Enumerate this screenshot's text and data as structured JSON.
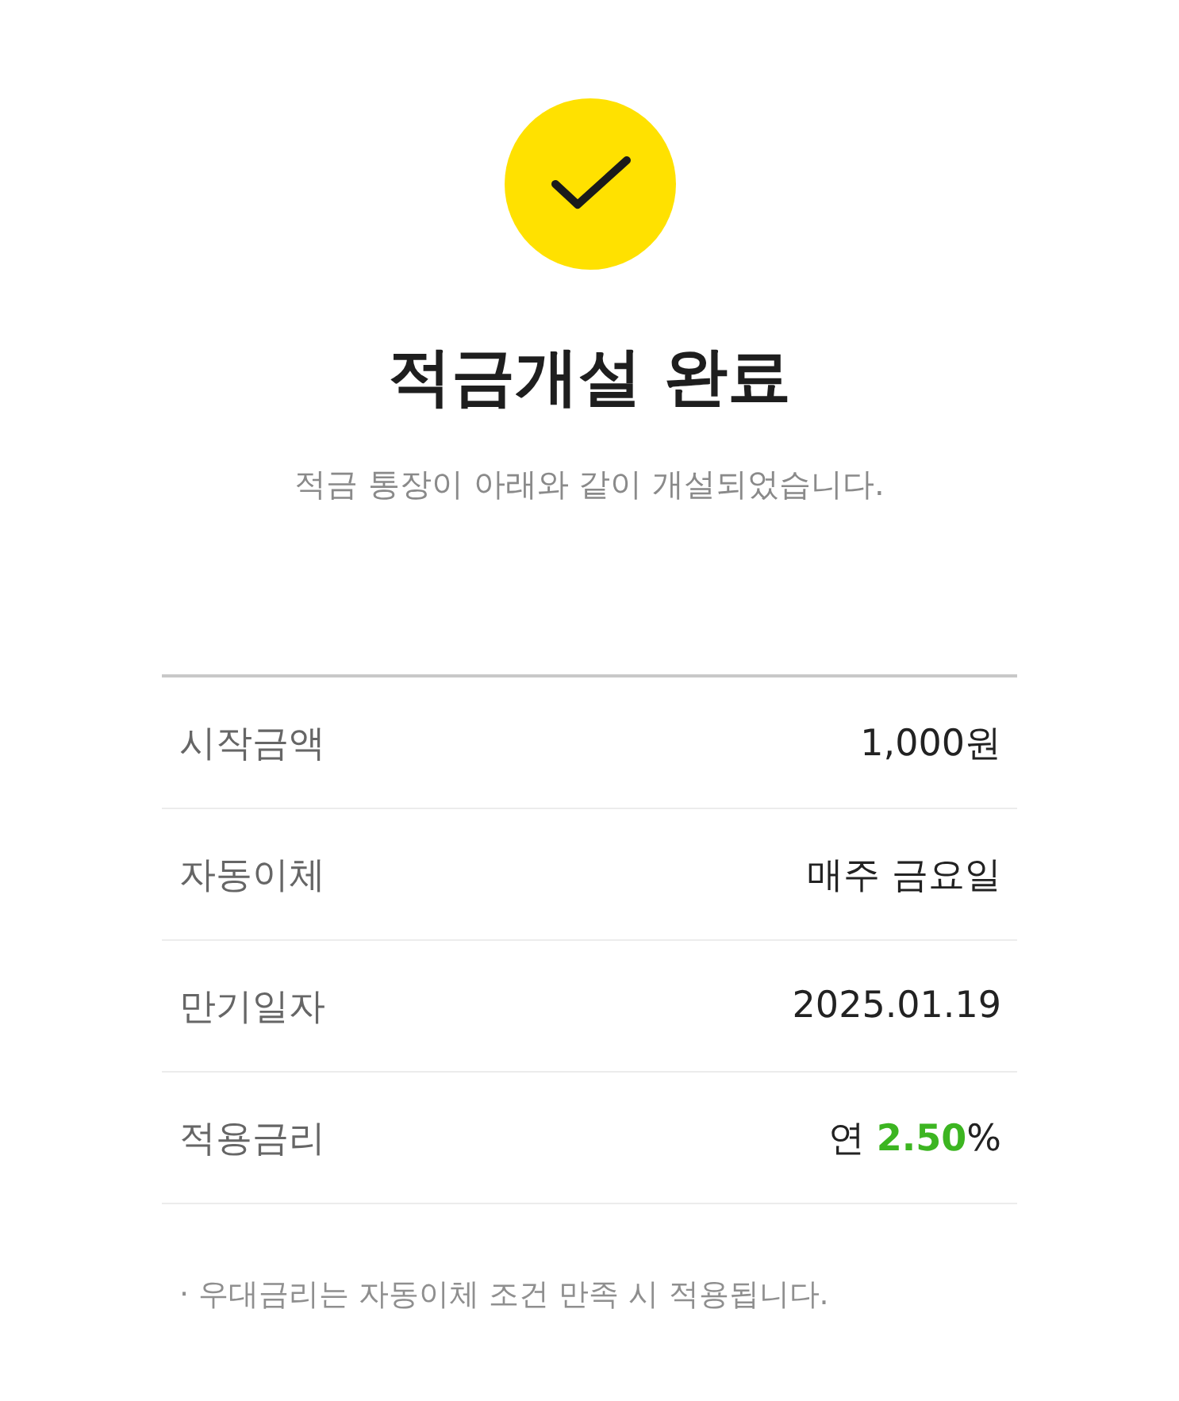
{
  "status_icon": {
    "kind": "success"
  },
  "title": "적금개설 완료",
  "subtitle": "적금 통장이 아래와 같이 개설되었습니다.",
  "details": [
    {
      "label": "시작금액",
      "value": "1,000원"
    },
    {
      "label": "자동이체",
      "value": "매주 금요일"
    },
    {
      "label": "만기일자",
      "value": "2025.01.19"
    },
    {
      "label": "적용금리",
      "value": "연 **2.50**%"
    }
  ],
  "note": "· 우대금리는 자동이체 조건 만족 시 적용됩니다."
}
